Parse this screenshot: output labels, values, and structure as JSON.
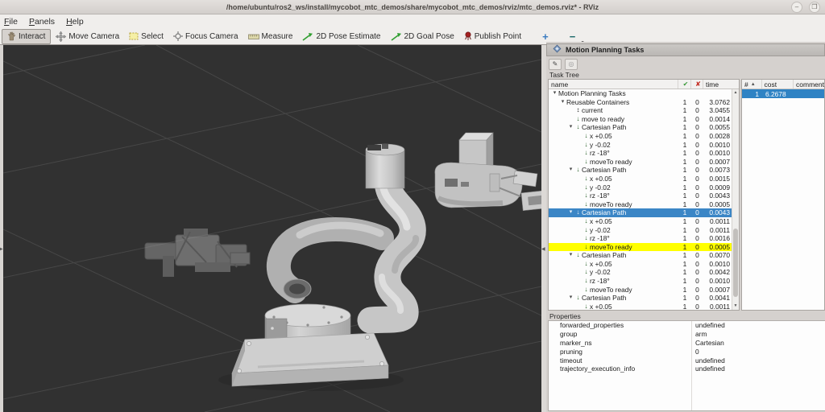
{
  "window": {
    "title": "/home/ubuntu/ros2_ws/install/mycobot_mtc_demos/share/mycobot_mtc_demos/rviz/mtc_demos.rviz* - RViz",
    "minimize_glyph": "–",
    "maximize_glyph": "❐"
  },
  "menu": {
    "items": [
      "File",
      "Panels",
      "Help"
    ]
  },
  "toolbar": {
    "buttons": [
      {
        "label": "Interact",
        "icon": "hand-icon",
        "pressed": true
      },
      {
        "label": "Move Camera",
        "icon": "move-camera-icon",
        "pressed": false
      },
      {
        "label": "Select",
        "icon": "select-box-icon",
        "pressed": false
      },
      {
        "label": "Focus Camera",
        "icon": "focus-crosshair-icon",
        "pressed": false
      },
      {
        "label": "Measure",
        "icon": "measure-ruler-icon",
        "pressed": false
      },
      {
        "label": "2D Pose Estimate",
        "icon": "green-arrow-icon",
        "pressed": false
      },
      {
        "label": "2D Goal Pose",
        "icon": "green-arrow-icon",
        "pressed": false
      },
      {
        "label": "Publish Point",
        "icon": "map-pin-icon",
        "pressed": false
      }
    ],
    "add_label": "+",
    "remove_label": "−"
  },
  "icons": {
    "expanded": "▾",
    "stage_down": "↓",
    "stage_updown": "↕",
    "check": "✔",
    "cross": "✘",
    "scroll_up": "▲",
    "scroll_down": "▼",
    "sort_asc": "▲",
    "splitter_left": "◀",
    "splitter_right": "▶",
    "tool_edit": "✎",
    "tool_target": "◎"
  },
  "panel": {
    "title": "Motion Planning Tasks",
    "task_tree_label": "Task Tree",
    "properties_label": "Properties",
    "tree": {
      "columns": {
        "name": "name",
        "time": "time"
      },
      "rows": [
        {
          "level": 0,
          "expander": true,
          "icon": null,
          "name": "Motion Planning Tasks",
          "success": "",
          "failure": "",
          "time": ""
        },
        {
          "level": 1,
          "expander": true,
          "icon": null,
          "name": "Reusable Containers",
          "success": "1",
          "failure": "0",
          "time": "3.0762"
        },
        {
          "level": 2,
          "expander": false,
          "icon": "updown",
          "name": "current",
          "success": "1",
          "failure": "0",
          "time": "3.0455"
        },
        {
          "level": 2,
          "expander": false,
          "icon": "down",
          "name": "move to ready",
          "success": "1",
          "failure": "0",
          "time": "0.0014"
        },
        {
          "level": 2,
          "expander": true,
          "icon": "down",
          "name": "Cartesian Path",
          "success": "1",
          "failure": "0",
          "time": "0.0055"
        },
        {
          "level": 3,
          "expander": false,
          "icon": "down",
          "name": "x +0.05",
          "success": "1",
          "failure": "0",
          "time": "0.0028"
        },
        {
          "level": 3,
          "expander": false,
          "icon": "down",
          "name": "y -0.02",
          "success": "1",
          "failure": "0",
          "time": "0.0010"
        },
        {
          "level": 3,
          "expander": false,
          "icon": "down",
          "name": "rz -18°",
          "success": "1",
          "failure": "0",
          "time": "0.0010"
        },
        {
          "level": 3,
          "expander": false,
          "icon": "down",
          "name": "moveTo ready",
          "success": "1",
          "failure": "0",
          "time": "0.0007"
        },
        {
          "level": 2,
          "expander": true,
          "icon": "down",
          "name": "Cartesian Path",
          "success": "1",
          "failure": "0",
          "time": "0.0073"
        },
        {
          "level": 3,
          "expander": false,
          "icon": "down",
          "name": "x +0.05",
          "success": "1",
          "failure": "0",
          "time": "0.0015"
        },
        {
          "level": 3,
          "expander": false,
          "icon": "down",
          "name": "y -0.02",
          "success": "1",
          "failure": "0",
          "time": "0.0009"
        },
        {
          "level": 3,
          "expander": false,
          "icon": "down",
          "name": "rz -18°",
          "success": "1",
          "failure": "0",
          "time": "0.0043"
        },
        {
          "level": 3,
          "expander": false,
          "icon": "down",
          "name": "moveTo ready",
          "success": "1",
          "failure": "0",
          "time": "0.0005"
        },
        {
          "level": 2,
          "expander": true,
          "icon": "down",
          "name": "Cartesian Path",
          "success": "1",
          "failure": "0",
          "time": "0.0043",
          "state": "selected"
        },
        {
          "level": 3,
          "expander": false,
          "icon": "down",
          "name": "x +0.05",
          "success": "1",
          "failure": "0",
          "time": "0.0011"
        },
        {
          "level": 3,
          "expander": false,
          "icon": "down",
          "name": "y -0.02",
          "success": "1",
          "failure": "0",
          "time": "0.0011"
        },
        {
          "level": 3,
          "expander": false,
          "icon": "down",
          "name": "rz -18°",
          "success": "1",
          "failure": "0",
          "time": "0.0016"
        },
        {
          "level": 3,
          "expander": false,
          "icon": "down",
          "name": "moveTo ready",
          "success": "1",
          "failure": "0",
          "time": "0.0005",
          "state": "highlighted"
        },
        {
          "level": 2,
          "expander": true,
          "icon": "down",
          "name": "Cartesian Path",
          "success": "1",
          "failure": "0",
          "time": "0.0070"
        },
        {
          "level": 3,
          "expander": false,
          "icon": "down",
          "name": "x +0.05",
          "success": "1",
          "failure": "0",
          "time": "0.0010"
        },
        {
          "level": 3,
          "expander": false,
          "icon": "down",
          "name": "y -0.02",
          "success": "1",
          "failure": "0",
          "time": "0.0042"
        },
        {
          "level": 3,
          "expander": false,
          "icon": "down",
          "name": "rz -18°",
          "success": "1",
          "failure": "0",
          "time": "0.0010"
        },
        {
          "level": 3,
          "expander": false,
          "icon": "down",
          "name": "moveTo ready",
          "success": "1",
          "failure": "0",
          "time": "0.0007"
        },
        {
          "level": 2,
          "expander": true,
          "icon": "down",
          "name": "Cartesian Path",
          "success": "1",
          "failure": "0",
          "time": "0.0041"
        },
        {
          "level": 3,
          "expander": false,
          "icon": "down",
          "name": "x +0.05",
          "success": "1",
          "failure": "0",
          "time": "0.0011"
        }
      ]
    },
    "solutions": {
      "columns": {
        "num": "#",
        "cost": "cost",
        "comment": "comment"
      },
      "rows": [
        {
          "num": "1",
          "cost": "6.2678",
          "comment": "",
          "state": "selected"
        }
      ]
    },
    "properties": {
      "rows": [
        {
          "name": "forwarded_properties",
          "value": "undefined"
        },
        {
          "name": "group",
          "value": "arm"
        },
        {
          "name": "marker_ns",
          "value": "Cartesian"
        },
        {
          "name": "pruning",
          "value": "0"
        },
        {
          "name": "timeout",
          "value": "undefined"
        },
        {
          "name": "trajectory_execution_info",
          "value": "undefined"
        }
      ]
    }
  },
  "colors": {
    "selection_blue": "#3b86c6",
    "highlight_yellow": "#ffff00",
    "viewport_bg": "#313131",
    "grid_line": "#474747",
    "success_green": "#3a9a3a",
    "failure_red": "#c3271d"
  }
}
